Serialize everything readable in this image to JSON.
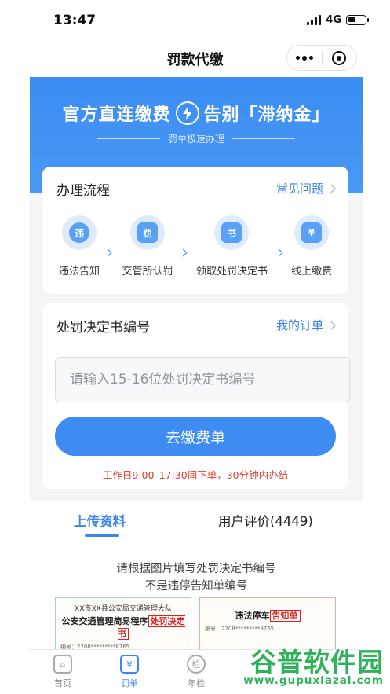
{
  "status_bar": {
    "time": "13:47",
    "network": "4G"
  },
  "nav": {
    "title": "罚款代缴"
  },
  "banner": {
    "headline_left": "官方直连缴费",
    "headline_right": "告别「滞纳金」",
    "subline": "罚单极速办理"
  },
  "flow_card": {
    "title": "办理流程",
    "faq_link": "常见问题",
    "steps": [
      {
        "label": "违法告知",
        "icon": "violation-notice-icon",
        "glyph": "违"
      },
      {
        "label": "交管所认罚",
        "icon": "penalty-form-icon",
        "glyph": "罚"
      },
      {
        "label": "领取处罚决定书",
        "icon": "decision-document-icon",
        "glyph": "书"
      },
      {
        "label": "线上缴费",
        "icon": "online-payment-icon",
        "glyph": "¥"
      }
    ]
  },
  "form_card": {
    "title": "处罚决定书编号",
    "orders_link": "我的订单",
    "input_placeholder": "请输入15-16位处罚决定书编号",
    "input_value": "",
    "submit_label": "去缴费单",
    "worktime_note": "工作日9:00–17:30间下单，30分钟内办结"
  },
  "tabs": {
    "upload": "上传资料",
    "reviews": "用户评价(4449)",
    "active": "upload"
  },
  "upload_hint": {
    "line1": "请根据图片填写处罚决定书编号",
    "line2": "不是违停告知单编号"
  },
  "sample_docs": {
    "left": {
      "header": "XX市XX县公安局交通管理大队",
      "title_prefix": "公安交通管理简易程序",
      "title_mark": "处罚决定书",
      "number": "编号：2208*********8765"
    },
    "right": {
      "title_prefix": "违法停车",
      "title_mark": "告知单",
      "number": "编号：2208*********8765"
    }
  },
  "tabbar": {
    "items": [
      {
        "label": "首页",
        "icon": "home-icon"
      },
      {
        "label": "罚单",
        "icon": "ticket-icon"
      },
      {
        "label": "年检",
        "icon": "inspection-icon"
      }
    ],
    "active": "罚单"
  },
  "watermark": {
    "brand": "谷普软件园",
    "url": "www.gupuxlazal.com"
  },
  "colors": {
    "accent": "#3a86ee",
    "banner": "#3b8df3",
    "warning": "#e03a2c",
    "watermark": "#2fb35a"
  }
}
